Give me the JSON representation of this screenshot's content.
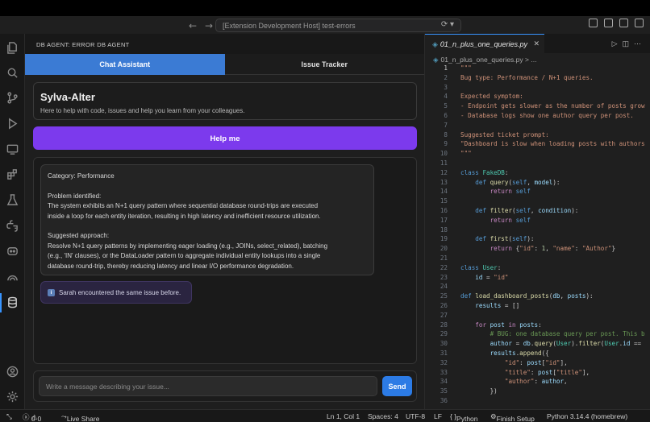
{
  "titlebar": {
    "search_text": "[Extension Development Host] test-errors"
  },
  "panel": {
    "title": "DB AGENT: ERROR DB AGENT",
    "tabs": [
      {
        "label": "Chat Assistant",
        "active": true
      },
      {
        "label": "Issue Tracker",
        "active": false
      }
    ],
    "hero": {
      "name": "Sylva-Alter",
      "tagline": "Here to help with code, issues and help you learn from your colleagues."
    },
    "help_button": "Help me",
    "message": {
      "category": "Category: Performance",
      "problem_heading": "Problem identified:",
      "problem_line1": "The system exhibits an N+1 query pattern where sequential database round-trips are executed",
      "problem_line2": "inside a loop for each entity iteration, resulting in high latency and inefficient resource utilization.",
      "approach_heading": "Suggested approach:",
      "approach_line1": "Resolve N+1 query patterns by implementing eager loading (e.g., JOINs, select_related), batching",
      "approach_line2": "(e.g., 'IN' clauses), or the DataLoader pattern to aggregate individual entity lookups into a single",
      "approach_line3": "database round-trip, thereby reducing latency and linear I/O performance degradation."
    },
    "note": "Sarah encountered the same issue before.",
    "composer": {
      "placeholder": "Write a message describing your issue...",
      "send_label": "Send"
    }
  },
  "editor": {
    "tab_label": "01_n_plus_one_queries.py",
    "breadcrumb_file": "01_n_plus_one_queries.py",
    "breadcrumb_rest": "> ...",
    "lines": [
      {
        "n": "1",
        "t": "\"\"\""
      },
      {
        "n": "2",
        "t": "Bug type: Performance / N+1 queries."
      },
      {
        "n": "3",
        "t": ""
      },
      {
        "n": "4",
        "t": "Expected symptom:"
      },
      {
        "n": "5",
        "t": "- Endpoint gets slower as the number of posts grow"
      },
      {
        "n": "6",
        "t": "- Database logs show one author query per post."
      },
      {
        "n": "7",
        "t": ""
      },
      {
        "n": "8",
        "t": "Suggested ticket prompt:"
      },
      {
        "n": "9",
        "t": "\"Dashboard is slow when loading posts with authors"
      },
      {
        "n": "10",
        "t": "\"\"\""
      },
      {
        "n": "11",
        "t": ""
      },
      {
        "n": "12",
        "t": "class FakeDB:"
      },
      {
        "n": "13",
        "t": "    def query(self, model):"
      },
      {
        "n": "14",
        "t": "        return self"
      },
      {
        "n": "15",
        "t": ""
      },
      {
        "n": "16",
        "t": "    def filter(self, condition):"
      },
      {
        "n": "17",
        "t": "        return self"
      },
      {
        "n": "18",
        "t": ""
      },
      {
        "n": "19",
        "t": "    def first(self):"
      },
      {
        "n": "20",
        "t": "        return {\"id\": 1, \"name\": \"Author\"}"
      },
      {
        "n": "21",
        "t": ""
      },
      {
        "n": "22",
        "t": "class User:"
      },
      {
        "n": "23",
        "t": "    id = \"id\""
      },
      {
        "n": "24",
        "t": ""
      },
      {
        "n": "25",
        "t": "def load_dashboard_posts(db, posts):"
      },
      {
        "n": "26",
        "t": "    results = []"
      },
      {
        "n": "27",
        "t": ""
      },
      {
        "n": "28",
        "t": "    for post in posts:"
      },
      {
        "n": "29",
        "t": "        # BUG: one database query per post. This b"
      },
      {
        "n": "30",
        "t": "        author = db.query(User).filter(User.id =="
      },
      {
        "n": "31",
        "t": "        results.append({"
      },
      {
        "n": "32",
        "t": "            \"id\": post[\"id\"],"
      },
      {
        "n": "33",
        "t": "            \"title\": post[\"title\"],"
      },
      {
        "n": "34",
        "t": "            \"author\": author,"
      },
      {
        "n": "35",
        "t": "        })"
      },
      {
        "n": "36",
        "t": ""
      }
    ]
  },
  "statusbar": {
    "errors": "0",
    "warnings": "0",
    "live_share": "Live Share",
    "position": "Ln 1, Col 1",
    "spaces": "Spaces: 4",
    "encoding": "UTF-8",
    "eol": "LF",
    "language": "Python",
    "finish_setup": "Finish Setup",
    "interpreter": "Python 3.14.4 (homebrew)"
  },
  "colors": {
    "accent_blue": "#3b7bd4",
    "help_purple": "#7c3aed",
    "send_blue": "#2c7be5"
  }
}
